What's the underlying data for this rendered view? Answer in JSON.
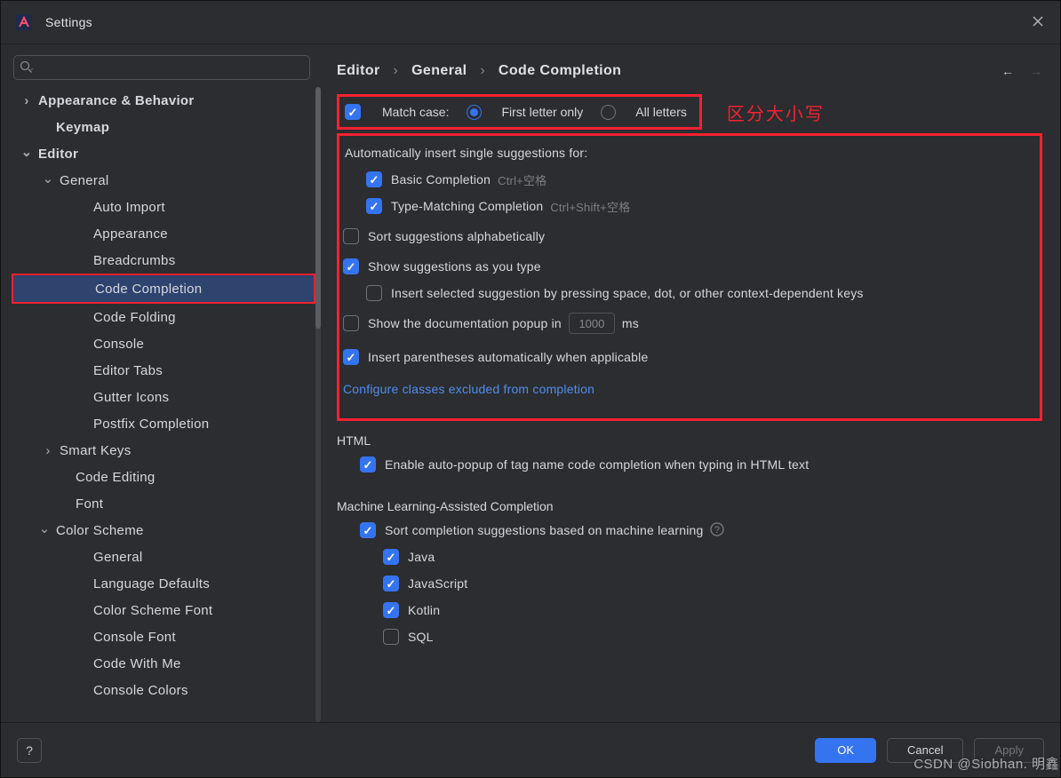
{
  "window": {
    "title": "Settings"
  },
  "search": {
    "placeholder": "",
    "value": ""
  },
  "sidebar": {
    "items": [
      {
        "label": "Appearance & Behavior",
        "level": 0,
        "arrow": "right",
        "bold": true
      },
      {
        "label": "Keymap",
        "level": 0,
        "arrow": "",
        "bold": true
      },
      {
        "label": "Editor",
        "level": 0,
        "arrow": "down",
        "bold": true
      },
      {
        "label": "General",
        "level": 1,
        "arrow": "down",
        "bold": false
      },
      {
        "label": "Auto Import",
        "level": 2,
        "arrow": "",
        "bold": false
      },
      {
        "label": "Appearance",
        "level": 2,
        "arrow": "",
        "bold": false
      },
      {
        "label": "Breadcrumbs",
        "level": 2,
        "arrow": "",
        "bold": false
      },
      {
        "label": "Code Completion",
        "level": 2,
        "arrow": "",
        "bold": false,
        "selected": true
      },
      {
        "label": "Code Folding",
        "level": 2,
        "arrow": "",
        "bold": false
      },
      {
        "label": "Console",
        "level": 2,
        "arrow": "",
        "bold": false
      },
      {
        "label": "Editor Tabs",
        "level": 2,
        "arrow": "",
        "bold": false
      },
      {
        "label": "Gutter Icons",
        "level": 2,
        "arrow": "",
        "bold": false
      },
      {
        "label": "Postfix Completion",
        "level": 2,
        "arrow": "",
        "bold": false
      },
      {
        "label": "Smart Keys",
        "level": 1,
        "arrow": "right",
        "bold": false
      },
      {
        "label": "Code Editing",
        "level": 1,
        "arrow": "",
        "bold": false,
        "pad": -1
      },
      {
        "label": "Font",
        "level": 1,
        "arrow": "",
        "bold": false,
        "pad": -1
      },
      {
        "label": "Color Scheme",
        "level": 0,
        "arrow": "down",
        "bold": false,
        "pad": 1
      },
      {
        "label": "General",
        "level": 2,
        "arrow": "",
        "bold": false
      },
      {
        "label": "Language Defaults",
        "level": 2,
        "arrow": "",
        "bold": false
      },
      {
        "label": "Color Scheme Font",
        "level": 2,
        "arrow": "",
        "bold": false
      },
      {
        "label": "Console Font",
        "level": 2,
        "arrow": "",
        "bold": false
      },
      {
        "label": "Code With Me",
        "level": 2,
        "arrow": "",
        "bold": false
      },
      {
        "label": "Console Colors",
        "level": 2,
        "arrow": "",
        "bold": false
      }
    ]
  },
  "breadcrumb": {
    "a": "Editor",
    "b": "General",
    "c": "Code Completion"
  },
  "annotation": {
    "match_case": "区分大小写"
  },
  "settings": {
    "match_case": {
      "label": "Match case:",
      "first": "First letter only",
      "all": "All letters"
    },
    "auto_insert": {
      "title": "Automatically insert single suggestions for:",
      "basic": {
        "label": "Basic Completion",
        "hint": "Ctrl+空格"
      },
      "type": {
        "label": "Type-Matching Completion",
        "hint": "Ctrl+Shift+空格"
      }
    },
    "sort_alpha": "Sort suggestions alphabetically",
    "as_you_type": "Show suggestions as you type",
    "insert_selected": "Insert selected suggestion by pressing space, dot, or other context-dependent keys",
    "doc_popup": {
      "label": "Show the documentation popup in",
      "value": "1000",
      "suffix": "ms"
    },
    "insert_paren": "Insert parentheses automatically when applicable",
    "configure_link": "Configure classes excluded from completion",
    "html": {
      "title": "HTML",
      "enable": "Enable auto-popup of tag name code completion when typing in HTML text"
    },
    "ml": {
      "title": "Machine Learning-Assisted Completion",
      "sort": "Sort completion suggestions based on machine learning",
      "java": "Java",
      "js": "JavaScript",
      "kotlin": "Kotlin",
      "sql": "SQL"
    }
  },
  "footer": {
    "ok": "OK",
    "cancel": "Cancel",
    "apply": "Apply"
  },
  "watermark": "CSDN @Siobhan. 明鑫"
}
